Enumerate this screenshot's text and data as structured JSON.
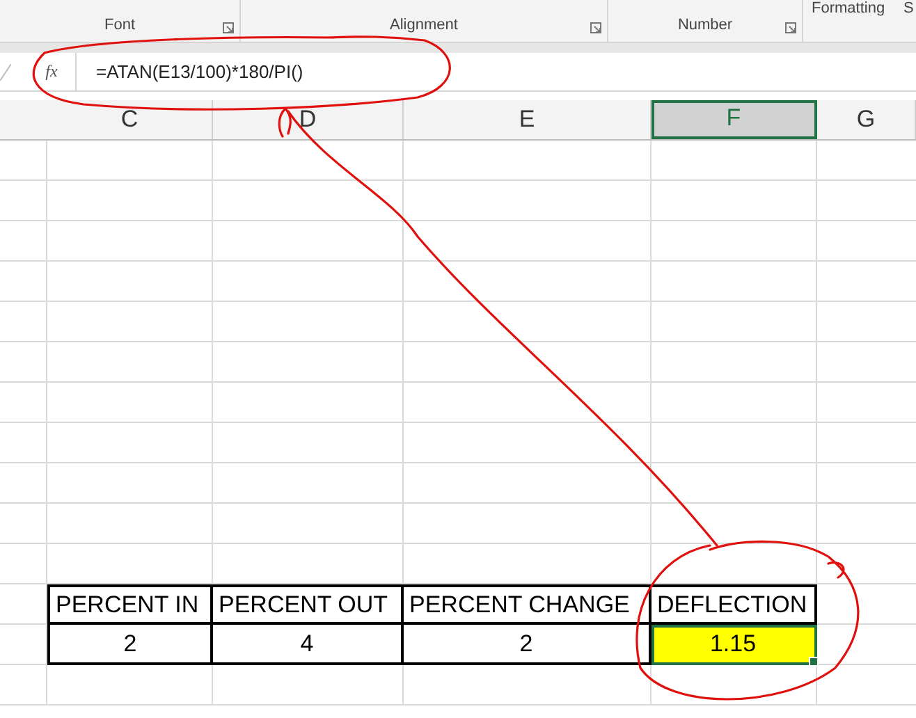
{
  "ribbon": {
    "groups": [
      {
        "label": "Font",
        "launcher": true
      },
      {
        "label": "Alignment",
        "launcher": true
      },
      {
        "label": "Number",
        "launcher": true
      },
      {
        "label": "Formatting",
        "launcher": false
      },
      {
        "label": "S",
        "launcher": false
      }
    ]
  },
  "formula_bar": {
    "function_label": "fx",
    "value": "=ATAN(E13/100)*180/PI()"
  },
  "columns": [
    {
      "label": "C",
      "selected": false
    },
    {
      "label": "D",
      "selected": false
    },
    {
      "label": "E",
      "selected": false
    },
    {
      "label": "F",
      "selected": true
    },
    {
      "label": "G",
      "selected": false
    }
  ],
  "rows": [
    {
      "kind": "empty"
    },
    {
      "kind": "empty"
    },
    {
      "kind": "empty"
    },
    {
      "kind": "empty"
    },
    {
      "kind": "empty"
    },
    {
      "kind": "empty"
    },
    {
      "kind": "empty"
    },
    {
      "kind": "empty"
    },
    {
      "kind": "empty"
    },
    {
      "kind": "empty"
    },
    {
      "kind": "empty"
    },
    {
      "kind": "table_header",
      "cells": [
        {
          "text": "PERCENT IN",
          "selected": false,
          "highlighted": false
        },
        {
          "text": "PERCENT OUT",
          "selected": false,
          "highlighted": false
        },
        {
          "text": "PERCENT CHANGE",
          "selected": false,
          "highlighted": false
        },
        {
          "text": "DEFLECTION",
          "selected": false,
          "highlighted": false
        }
      ]
    },
    {
      "kind": "table_data",
      "cells": [
        {
          "text": "2",
          "selected": false,
          "highlighted": false
        },
        {
          "text": "4",
          "selected": false,
          "highlighted": false
        },
        {
          "text": "2",
          "selected": false,
          "highlighted": false
        },
        {
          "text": "1.15",
          "selected": true,
          "highlighted": true
        }
      ]
    },
    {
      "kind": "empty"
    }
  ]
}
